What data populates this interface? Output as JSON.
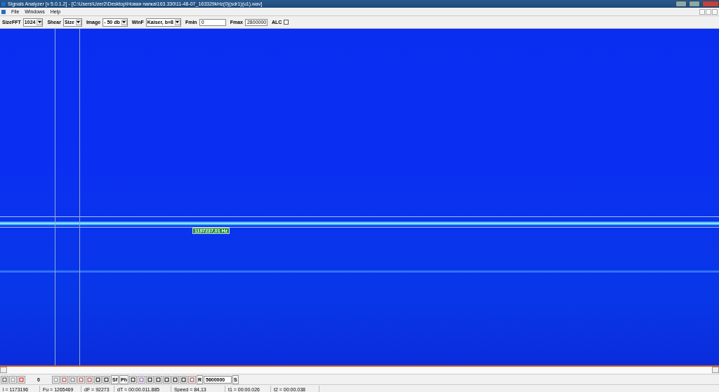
{
  "window": {
    "title": "Signals Analyzer [v 5.0.1.2] - [C:\\Users\\Uzer2\\Desktop\\Новая папка\\163.330\\11-48-07_163329kHz(0)(sdr1)(u1).wav]"
  },
  "menu": [
    "File",
    "Windows",
    "Help"
  ],
  "toolbar": [
    {
      "label": "SizeFFT",
      "kind": "combo",
      "value": "1024"
    },
    {
      "label": "Shear",
      "kind": "combo",
      "value": "Size"
    },
    {
      "label": "Image",
      "kind": "combo",
      "value": "- 50 db"
    },
    {
      "label": "WinF",
      "kind": "combo",
      "value": "Kaiser, b=8"
    },
    {
      "label": "Fmin",
      "kind": "field",
      "value": "0"
    },
    {
      "label": "Fmax",
      "kind": "field",
      "value": "2800000"
    },
    {
      "label": "ALC",
      "kind": "check",
      "checked": false
    }
  ],
  "spectrogram": {
    "marker": "1197237,01 Hz"
  },
  "bottom_toolbar": {
    "counter": "0",
    "sf": "Sf",
    "ph": "Ph",
    "r": "R",
    "sample_rate": "5600000",
    "s": "S"
  },
  "status_bar": [
    "l = 1173196",
    "Fu = 1265469",
    "dF = 92273",
    "dT = 00:00.011.885",
    "Speed = 84,13",
    "t1 = 00:00.026",
    "t2 = 00:00.038"
  ]
}
